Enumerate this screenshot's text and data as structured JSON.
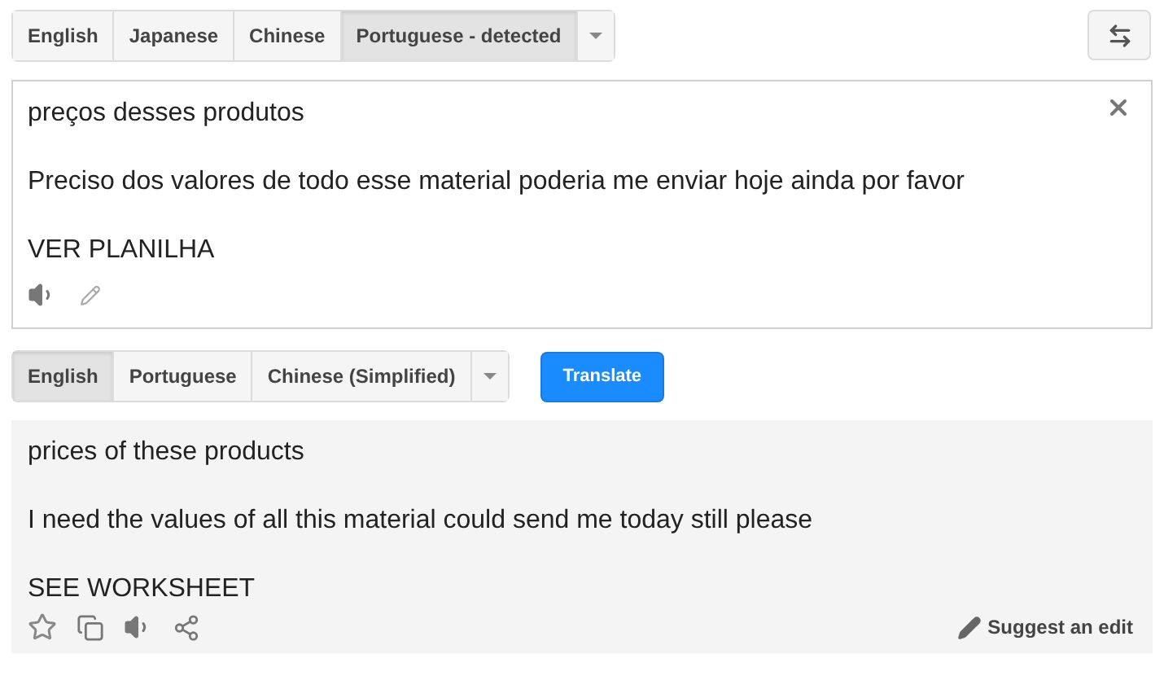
{
  "source_tabs": [
    {
      "label": "English",
      "selected": false
    },
    {
      "label": "Japanese",
      "selected": false
    },
    {
      "label": "Chinese",
      "selected": false
    },
    {
      "label": "Portuguese - detected",
      "selected": true
    }
  ],
  "source_lines": [
    "preços desses produtos",
    "Preciso dos valores de todo esse material poderia me enviar hoje ainda por favor",
    "VER PLANILHA"
  ],
  "target_tabs": [
    {
      "label": "English",
      "selected": true
    },
    {
      "label": "Portuguese",
      "selected": false
    },
    {
      "label": "Chinese (Simplified)",
      "selected": false
    }
  ],
  "translate_button": "Translate",
  "result_lines": [
    "prices of these products",
    "I need the values of all this material could send me today still please",
    "SEE WORKSHEET"
  ],
  "suggest_edit": "Suggest an edit"
}
